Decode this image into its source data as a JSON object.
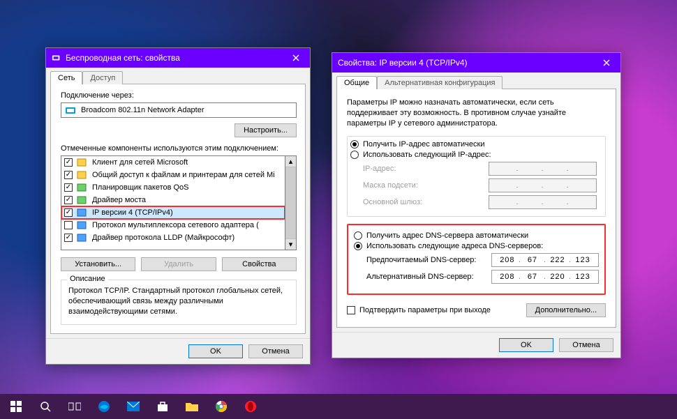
{
  "left": {
    "title": "Беспроводная сеть: свойства",
    "tabs": {
      "network": "Сеть",
      "access": "Доступ"
    },
    "connect_using_label": "Подключение через:",
    "adapter": "Broadcom 802.11n Network Adapter",
    "configure": "Настроить...",
    "components_label": "Отмеченные компоненты используются этим подключением:",
    "items": [
      {
        "label": "Клиент для сетей Microsoft",
        "checked": true
      },
      {
        "label": "Общий доступ к файлам и принтерам для сетей Mi",
        "checked": true
      },
      {
        "label": "Планировщик пакетов QoS",
        "checked": true
      },
      {
        "label": "Драйвер моста",
        "checked": true
      },
      {
        "label": "IP версии 4 (TCP/IPv4)",
        "checked": true,
        "selected": true
      },
      {
        "label": "Протокол мультиплексора сетевого адаптера (",
        "checked": false
      },
      {
        "label": "Драйвер протокола LLDP (Майкрософт)",
        "checked": true
      }
    ],
    "install": "Установить...",
    "uninstall": "Удалить",
    "properties": "Свойства",
    "description_label": "Описание",
    "description": "Протокол TCP/IP. Стандартный протокол глобальных сетей, обеспечивающий связь между различными взаимодействующими сетями.",
    "ok": "OK",
    "cancel": "Отмена"
  },
  "right": {
    "title": "Свойства: IP версии 4 (TCP/IPv4)",
    "tabs": {
      "general": "Общие",
      "alt": "Альтернативная конфигурация"
    },
    "intro": "Параметры IP можно назначать автоматически, если сеть поддерживает эту возможность. В противном случае узнайте параметры IP у сетевого администратора.",
    "ip_auto": "Получить IP-адрес автоматически",
    "ip_manual": "Использовать следующий IP-адрес:",
    "ip_address_label": "IP-адрес:",
    "mask_label": "Маска подсети:",
    "gateway_label": "Основной шлюз:",
    "dns_auto": "Получить адрес DNS-сервера автоматически",
    "dns_manual": "Использовать следующие адреса DNS-серверов:",
    "dns_pref_label": "Предпочитаемый DNS-сервер:",
    "dns_alt_label": "Альтернативный DNS-сервер:",
    "dns_pref_value": [
      "208",
      "67",
      "222",
      "123"
    ],
    "dns_alt_value": [
      "208",
      "67",
      "220",
      "123"
    ],
    "validate": "Подтвердить параметры при выходе",
    "advanced": "Дополнительно...",
    "ok": "OK",
    "cancel": "Отмена"
  }
}
